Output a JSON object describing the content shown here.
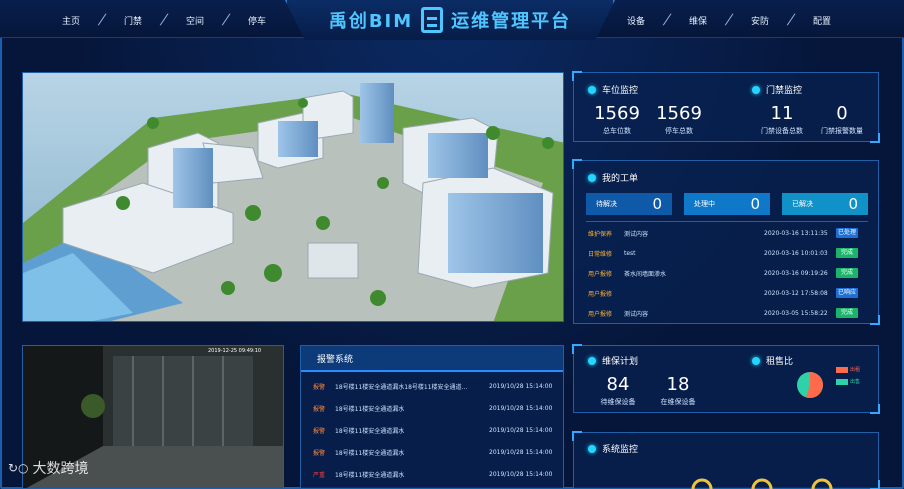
{
  "header": {
    "title": "禹创BIM",
    "title_rest": "运维管理平台",
    "nav_left": [
      "主页",
      "门禁",
      "空间",
      "停车"
    ],
    "nav_right": [
      "设备",
      "维保",
      "安防",
      "配置"
    ]
  },
  "parking": {
    "title": "车位监控",
    "total_value": "1569",
    "total_label": "总车位数",
    "park_value": "1569",
    "park_label": "停车总数"
  },
  "access": {
    "title": "门禁监控",
    "devices_value": "11",
    "devices_label": "门禁设备总数",
    "alarms_value": "0",
    "alarms_label": "门禁报警数量"
  },
  "work_orders": {
    "title": "我的工单",
    "pending_label": "待解决",
    "pending_value": "0",
    "processing_label": "处理中",
    "processing_value": "0",
    "resolved_label": "已解决",
    "resolved_value": "0",
    "rows": [
      {
        "type": "维护保养",
        "content": "测试内容",
        "time": "2020-03-16 13:11:35",
        "status": "已处理",
        "status_color": "#1e6fd6"
      },
      {
        "type": "日常维修",
        "content": "test",
        "time": "2020-03-16 10:01:03",
        "status": "完成",
        "status_color": "#1db36b"
      },
      {
        "type": "用户报修",
        "content": "茶水间墙面渗水",
        "time": "2020-03-16 09:19:26",
        "status": "完成",
        "status_color": "#1db36b"
      },
      {
        "type": "用户报修",
        "content": "",
        "time": "2020-03-12 17:58:08",
        "status": "已响应",
        "status_color": "#1e6fd6"
      },
      {
        "type": "用户报修",
        "content": "测试内容",
        "time": "2020-03-05 15:58:22",
        "status": "完成",
        "status_color": "#1db36b"
      }
    ]
  },
  "maintenance": {
    "title": "维保计划",
    "pending_value": "84",
    "pending_label": "待维保设备",
    "ongoing_value": "18",
    "ongoing_label": "在维保设备"
  },
  "rental": {
    "title": "租售比",
    "legend1": "出租",
    "legend2": "出售",
    "rent_color": "#ff6a4a",
    "sale_color": "#2fd1a8",
    "rent_fraction": 0.55
  },
  "system": {
    "title": "系统监控"
  },
  "alarm_system": {
    "title": "报警系统",
    "rows": [
      {
        "type": "报警",
        "text": "18号楼11楼安全通道漏水18号楼11楼安全通道...",
        "time": "2019/10/28 15:14:00"
      },
      {
        "type": "报警",
        "text": "18号楼11楼安全通道漏水",
        "time": "2019/10/28 15:14:00"
      },
      {
        "type": "报警",
        "text": "18号楼11楼安全通道漏水",
        "time": "2019/10/28 15:14:00"
      },
      {
        "type": "报警",
        "text": "18号楼11楼安全通道漏水",
        "time": "2019/10/28 15:14:00"
      },
      {
        "type": "严重",
        "text": "18号楼11楼安全通道漏水",
        "time": "2019/10/28 15:14:00"
      }
    ]
  },
  "watermark": "大数跨境",
  "cctv_timestamp": "2019-12-25 09:49:10"
}
